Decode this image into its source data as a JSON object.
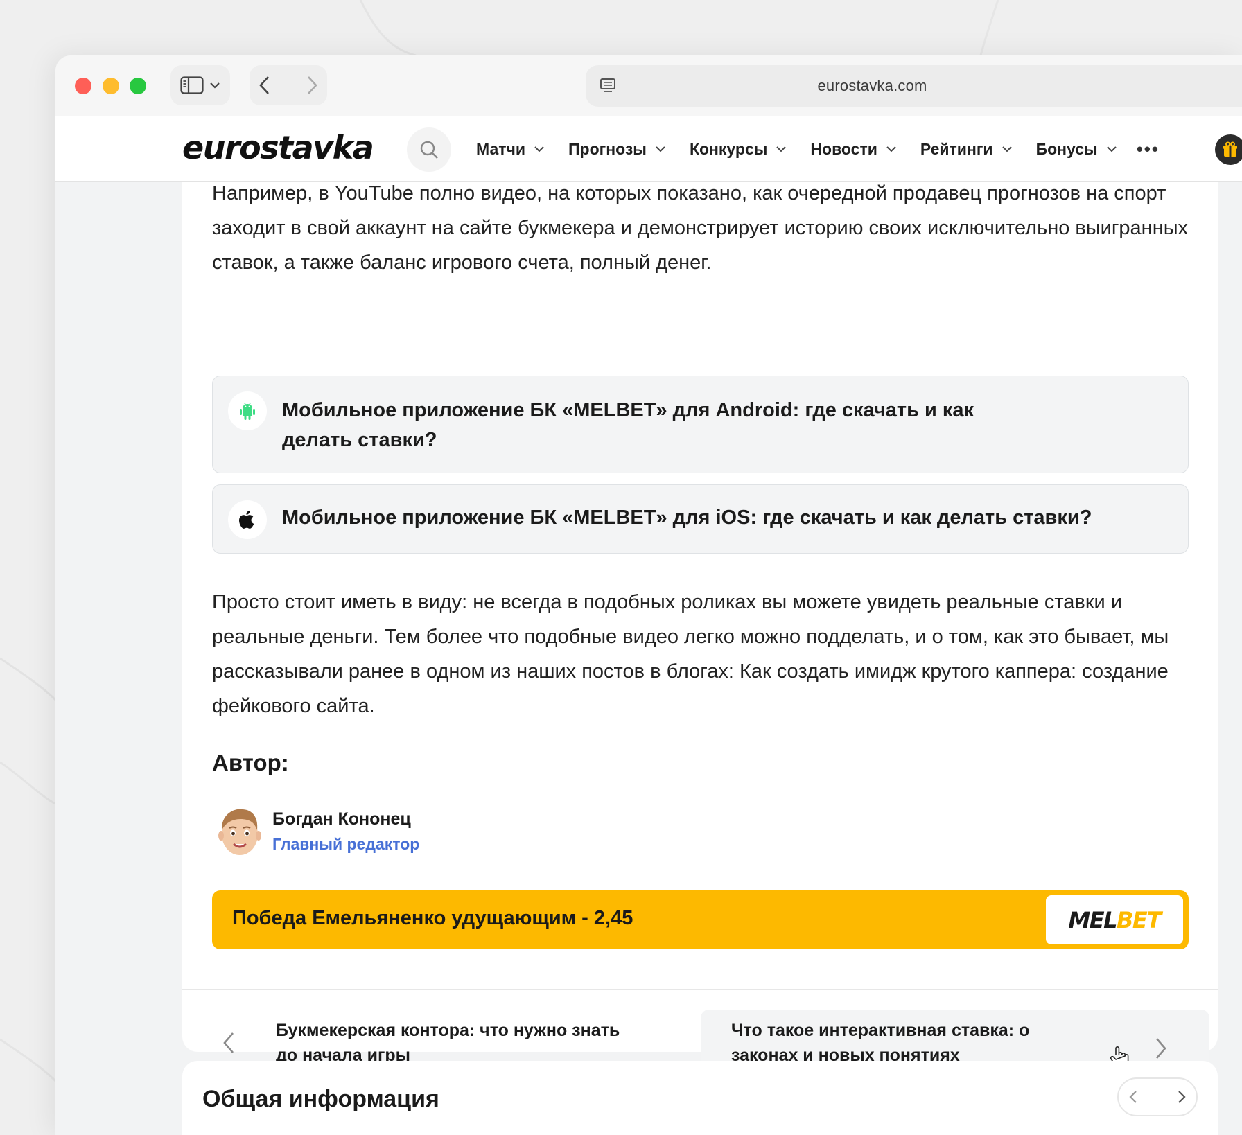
{
  "browser": {
    "url": "eurostavka.com"
  },
  "site": {
    "logo": "eurostavka",
    "menu": [
      {
        "label": "Матчи"
      },
      {
        "label": "Прогнозы"
      },
      {
        "label": "Конкурсы"
      },
      {
        "label": "Новости"
      },
      {
        "label": "Рейтинги"
      },
      {
        "label": "Бонусы"
      }
    ],
    "more_label": "•••"
  },
  "article": {
    "para1": "Например, в YouTube полно видео, на которых показано, как очередной продавец прогнозов на спорт заходит в свой аккаунт на сайте букмекера и демонстрирует историю своих исключительно выигранных ставок, а также баланс игрового счета, полный денег.",
    "link_android_line1": "Мобильное приложение БК «MELBET» для Android: где скачать и как",
    "link_android_line2": "делать ставки?",
    "link_ios": "Мобильное приложение БК «MELBET» для iOS: где скачать и как делать ставки?",
    "para2": "Просто стоит иметь в виду: не всегда в подобных роликах вы можете увидеть реальные ставки и реальные деньги. Тем более что подобные видео легко можно подделать, и о том, как это бывает, мы рассказывали ранее в одном из наших постов в блогах: Как создать имидж крутого каппера: создание фейкового сайта.",
    "author_heading": "Автор:",
    "author_name": "Богдан Кононец",
    "author_role": "Главный редактор",
    "bet_text": "Победа Емельяненко удущающим - 2,45",
    "bet_brand_a": "MEL",
    "bet_brand_b": "BET",
    "prev_line1": "Букмекерская контора: что нужно знать",
    "prev_line2": "до начала игры",
    "next_line1": "Что такое интерактивная ставка: о",
    "next_line2": "законах и новых понятиях"
  },
  "info": {
    "title": "Общая информация"
  },
  "colors": {
    "accent": "#fdb900",
    "link_blue": "#4770d6"
  }
}
